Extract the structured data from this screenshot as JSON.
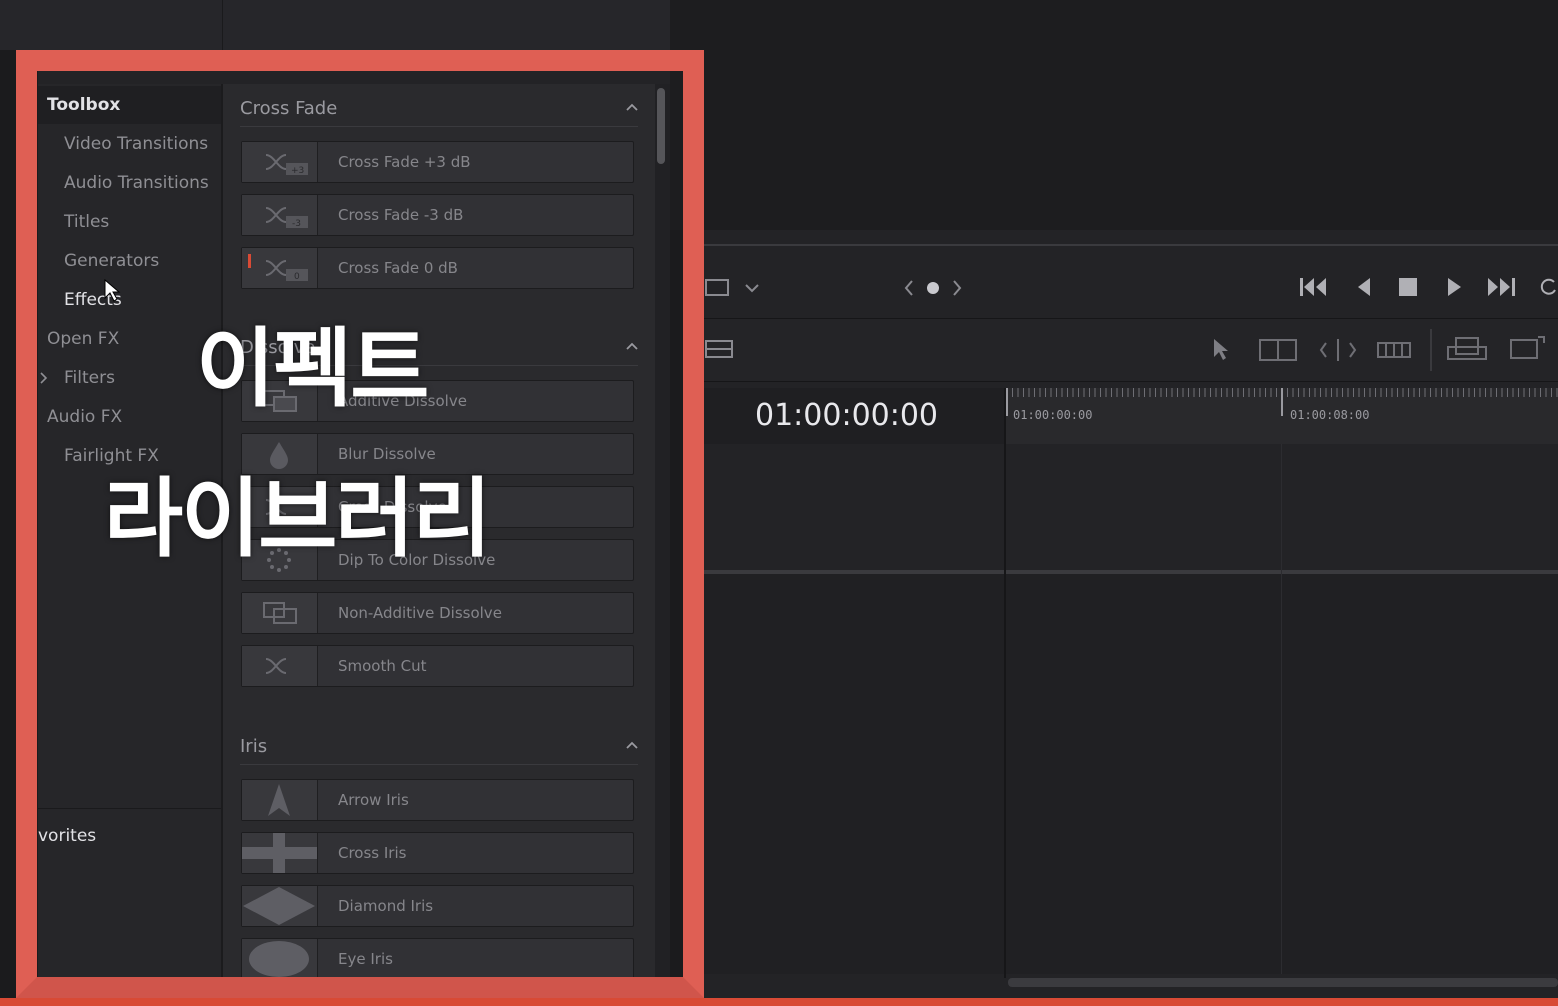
{
  "library": {
    "sidebar": {
      "items": [
        {
          "label": "Toolbox",
          "selected": true
        },
        {
          "label": "Video Transitions"
        },
        {
          "label": "Audio Transitions"
        },
        {
          "label": "Titles"
        },
        {
          "label": "Generators"
        },
        {
          "label": "Effects"
        },
        {
          "label": "Open FX"
        },
        {
          "label": "Filters"
        },
        {
          "label": "Audio FX"
        },
        {
          "label": "Fairlight FX"
        }
      ],
      "favorites_label": "vorites"
    },
    "sections": [
      {
        "title": "Cross Fade",
        "items": [
          "Cross Fade +3 dB",
          "Cross Fade -3 dB",
          "Cross Fade 0 dB"
        ]
      },
      {
        "title": "Dissolve",
        "items": [
          "Additive Dissolve",
          "Blur Dissolve",
          "Cross Dissolve",
          "Dip To Color Dissolve",
          "Non-Additive Dissolve",
          "Smooth Cut"
        ]
      },
      {
        "title": "Iris",
        "items": [
          "Arrow Iris",
          "Cross Iris",
          "Diamond Iris",
          "Eye Iris"
        ]
      }
    ]
  },
  "overlay": {
    "line1": "이펙트",
    "line2": "라이브러리"
  },
  "timeline": {
    "timecode": "01:00:00:00",
    "ruler_labels": [
      "01:00:00:00",
      "01:00:08:00"
    ]
  },
  "colors": {
    "highlight_frame": "#df5f54",
    "accent_red": "#d84a35"
  }
}
